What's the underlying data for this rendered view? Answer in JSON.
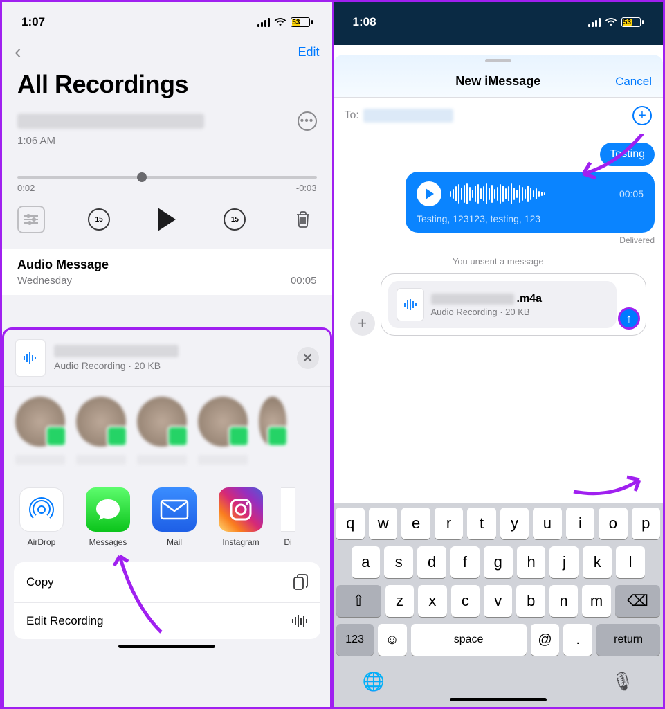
{
  "left": {
    "status": {
      "time": "1:07",
      "battery": "53"
    },
    "nav": {
      "edit": "Edit"
    },
    "title": "All Recordings",
    "current": {
      "subtitle": "1:06 AM",
      "elapsed": "0:02",
      "remaining": "-0:03"
    },
    "skip_back": "15",
    "skip_fwd": "15",
    "audio_msg": {
      "title": "Audio Message",
      "day": "Wednesday",
      "duration": "00:05"
    },
    "share": {
      "file_sub": "Audio Recording · 20 KB",
      "apps": {
        "airdrop": "AirDrop",
        "messages": "Messages",
        "mail": "Mail",
        "instagram": "Instagram",
        "dictionary": "Di"
      },
      "actions": {
        "copy": "Copy",
        "edit": "Edit Recording"
      }
    }
  },
  "right": {
    "status": {
      "time": "1:08",
      "battery": "53"
    },
    "header": {
      "title": "New iMessage",
      "cancel": "Cancel"
    },
    "to_label": "To:",
    "msg1": "Testing",
    "audio_dur": "00:05",
    "transcript": "Testing, 123123, testing, 123",
    "delivered": "Delivered",
    "unsent": "You unsent a message",
    "attach": {
      "ext": ".m4a",
      "sub": "Audio Recording · 20 KB"
    },
    "keyboard": {
      "row1": [
        "q",
        "w",
        "e",
        "r",
        "t",
        "y",
        "u",
        "i",
        "o",
        "p"
      ],
      "row2": [
        "a",
        "s",
        "d",
        "f",
        "g",
        "h",
        "j",
        "k",
        "l"
      ],
      "row3": [
        "z",
        "x",
        "c",
        "v",
        "b",
        "n",
        "m"
      ],
      "num": "123",
      "space": "space",
      "at": "@",
      "dot": ".",
      "return": "return"
    }
  }
}
